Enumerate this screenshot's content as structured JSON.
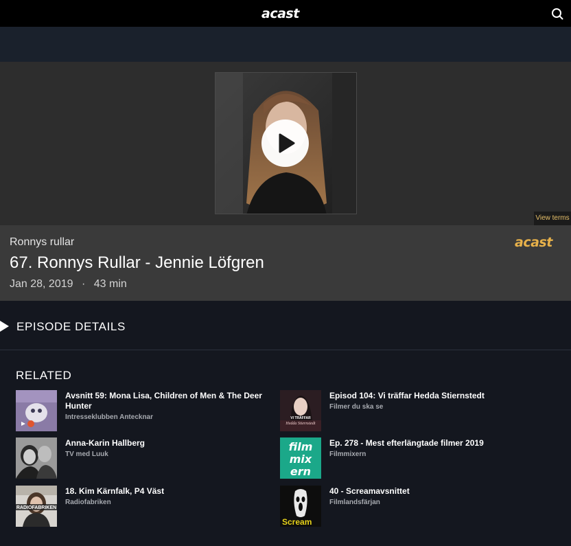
{
  "header": {
    "logo": "acast",
    "search_icon": "search-icon"
  },
  "player": {
    "play_icon": "play-icon",
    "view_terms": "View terms"
  },
  "episode": {
    "show_name": "Ronnys rullar",
    "title": "67. Ronnys Rullar - Jennie Löfgren",
    "date": "Jan 28, 2019",
    "separator": "·",
    "duration": "43 min",
    "brand_logo": "acast"
  },
  "details": {
    "label": "EPISODE DETAILS",
    "icon": "triangle-right-icon"
  },
  "related": {
    "heading": "RELATED",
    "items": [
      {
        "title": "Avsnitt 59: Mona Lisa, Children of Men & The Deer Hunter",
        "show": "Intresseklubben Antecknar"
      },
      {
        "title": "Episod 104: Vi träffar Hedda Stiernstedt",
        "show": "Filmer du ska se",
        "thumb_text_1": "VI TRÄFFAR",
        "thumb_text_2": "Hedda Stiernstedt"
      },
      {
        "title": "Anna-Karin Hallberg",
        "show": "TV med Luuk"
      },
      {
        "title": "Ep. 278 - Mest efterlängtade filmer 2019",
        "show": "Filmmixern",
        "thumb_text_1": "film",
        "thumb_text_2": "mix",
        "thumb_text_3": "ern"
      },
      {
        "title": "18. Kim Kärnfalk, P4 Väst",
        "show": "Radiofabriken",
        "thumb_text_1": "RADIOFABRIKEN"
      },
      {
        "title": "40 - Screamavsnittet",
        "show": "Filmlandsfärjan",
        "thumb_text_1": "Scream"
      }
    ]
  },
  "colors": {
    "page_bg": "#14171f",
    "topbar_bg": "#000000",
    "player_bg": "#2d2d2d",
    "info_bg": "#3a3a3a",
    "accent": "#e7b14a",
    "view_terms": "#e7c06a"
  }
}
